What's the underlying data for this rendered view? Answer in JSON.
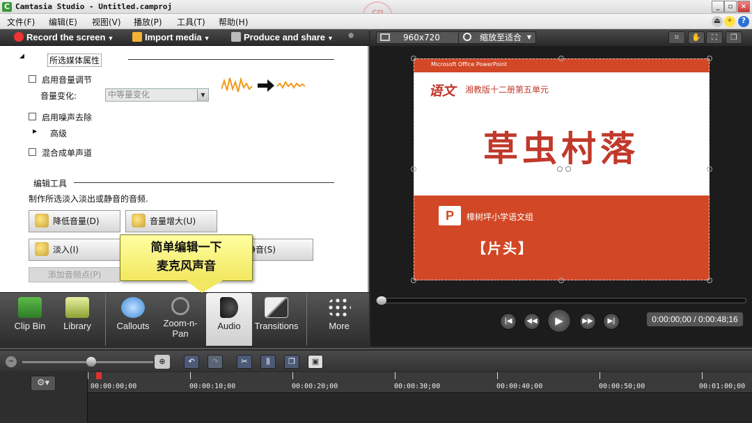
{
  "window": {
    "title": "Camtasia Studio - Untitled.camproj",
    "app_icon": "C",
    "min_label": "_",
    "max_label": "▫",
    "close_label": "×"
  },
  "watermark_logo": "印",
  "menu": [
    "文件(F)",
    "编辑(E)",
    "视图(V)",
    "播放(P)",
    "工具(T)",
    "帮助(H)"
  ],
  "toolbar": {
    "record": "Record the screen",
    "import": "Import media",
    "produce": "Produce and share"
  },
  "audio_panel": {
    "section_title": "所选媒体属性",
    "enable_volume": "启用音量调节",
    "volume_change_label": "音量变化:",
    "volume_select_value": "中等量变化",
    "enable_noise": "启用噪声去除",
    "advanced": "高级",
    "mix_mono": "混合成单声道",
    "edit_tools_title": "编辑工具",
    "edit_tools_desc": "制作所选淡入淡出或静音的音频.",
    "btn_lower": "降低音量(D)",
    "btn_raise": "音量增大(U)",
    "btn_fadein": "淡入(I)",
    "btn_silence": "静音(S)",
    "btn_add_point": "添加音频点(P)"
  },
  "tooltip": {
    "line1": "简单编辑一下",
    "line2": "麦克风声音"
  },
  "tabs": [
    {
      "label": "Clip Bin",
      "icon": "film-icon"
    },
    {
      "label": "Library",
      "icon": "folder-icon"
    },
    {
      "label": "Callouts",
      "icon": "speech-bubble-icon"
    },
    {
      "label": "Zoom-n-Pan",
      "icon": "magnifier-icon"
    },
    {
      "label": "Audio",
      "icon": "speaker-icon"
    },
    {
      "label": "Transitions",
      "icon": "transition-icon"
    },
    {
      "label": "More",
      "icon": "dots-icon"
    }
  ],
  "tab_labels": {
    "clipbin": "Clip Bin",
    "library": "Library",
    "callouts": "Callouts",
    "zoom_1": "Zoom-n-",
    "zoom_2": "Pan",
    "audio": "Audio",
    "transitions": "Transitions",
    "more": "More"
  },
  "preview": {
    "size": "960x720",
    "zoom": "缩放至适合",
    "time": "0:00:00;00 / 0:00:48;16"
  },
  "slide": {
    "top_label": "Microsoft Office PowerPoint",
    "subject": "语文",
    "subtitle": "湘教版十二册第五单元",
    "main_title": "草虫村落",
    "ppt_mark": "P",
    "school": "樟树坪小学语文组",
    "header_tag": "【片头】"
  },
  "timeline": {
    "ticks": [
      "00:00:00;00",
      "00:00:10;00",
      "00:00:20;00",
      "00:00:30;00",
      "00:00:40;00",
      "00:00:50;00",
      "00:01:00;00"
    ]
  },
  "colors": {
    "slide_red": "#d24726",
    "tooltip_yellow": "#f2e760",
    "title_red": "#c0392b"
  }
}
